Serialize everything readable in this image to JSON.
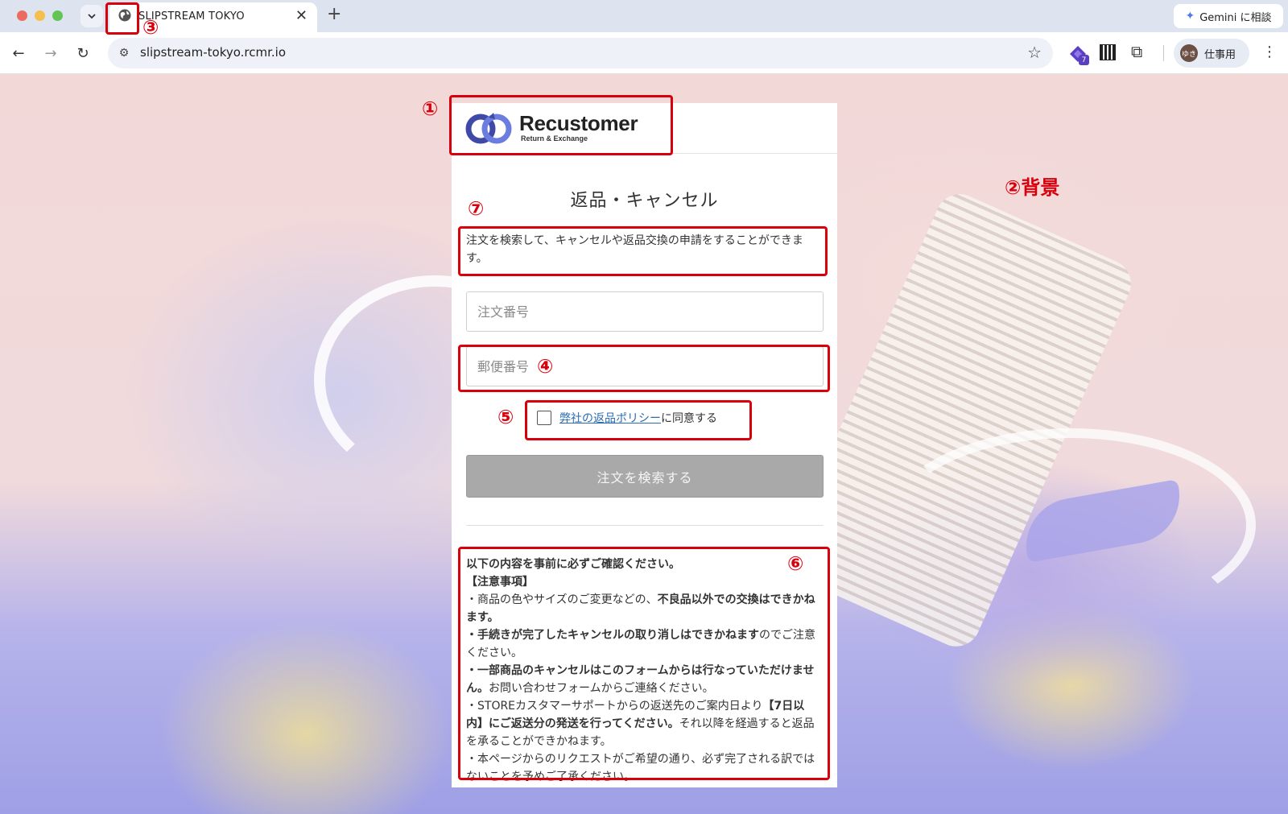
{
  "browser": {
    "tab_list_icon": "chevron-down-icon",
    "tab_title": "SLIPSTREAM TOKYO",
    "tab_close": "✕",
    "new_tab": "+",
    "gemini_label": "Gemini に相談",
    "url": "slipstream-tokyo.rcmr.io",
    "extension_badge": "7",
    "profile_avatar": "ゆき",
    "profile_label": "仕事用"
  },
  "card": {
    "logo_name": "Recustomer",
    "logo_sub": "Return & Exchange",
    "title": "返品・キャンセル",
    "description": "注文を検索して、キャンセルや返品交換の申請をすることができます。",
    "order_placeholder": "注文番号",
    "postal_placeholder": "郵便番号",
    "policy_link": "弊社の返品ポリシー",
    "agree_suffix": "に同意する",
    "search_button": "注文を検索する",
    "notice": {
      "intro": "以下の内容を事前に必ずご確認ください。",
      "heading": "【注意事項】",
      "item1_pre": "・商品の色やサイズのご変更などの、",
      "item1_bold": "不良品以外での交換はできかねます。",
      "item2_bold": "・手続きが完了したキャンセルの取り消しはできかねます",
      "item2_post": "のでご注意ください。",
      "item3_bold": "・一部商品のキャンセルはこのフォームからは行なっていただけません。",
      "item3_post": "お問い合わせフォームからご連絡ください。",
      "item4_pre": "・STOREカスタマーサポートからの返送先のご案内日より",
      "item4_bold": "【7日以内】にご返送分の発送を行ってください。",
      "item4_post": "それ以降を経過すると返品を承ることができかねます。",
      "item5": "・本ページからのリクエストがご希望の通り、必ず完了される訳ではないことを予めご了承ください。"
    }
  },
  "annotations": {
    "n1": "①",
    "n2": "②背景",
    "n3": "③",
    "n4": "④",
    "n5": "⑤",
    "n6": "⑥",
    "n7": "⑦"
  },
  "colors": {
    "annotation": "#d9000d",
    "button_disabled": "#a9a9a9",
    "link": "#2b6cb0"
  }
}
